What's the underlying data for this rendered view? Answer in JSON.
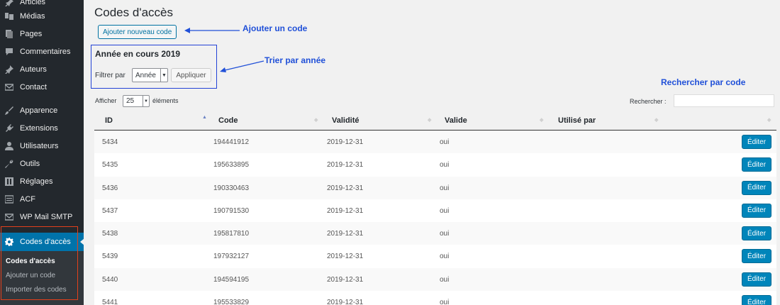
{
  "sidebar": {
    "items": [
      {
        "label": "Articles",
        "icon": "pin-icon"
      },
      {
        "label": "Médias",
        "icon": "media-icon"
      },
      {
        "label": "Pages",
        "icon": "page-icon"
      },
      {
        "label": "Commentaires",
        "icon": "comment-icon"
      },
      {
        "label": "Auteurs",
        "icon": "pin-icon"
      },
      {
        "label": "Contact",
        "icon": "mail-icon"
      },
      {
        "label": "Apparence",
        "icon": "brush-icon"
      },
      {
        "label": "Extensions",
        "icon": "plugin-icon"
      },
      {
        "label": "Utilisateurs",
        "icon": "user-icon"
      },
      {
        "label": "Outils",
        "icon": "wrench-icon"
      },
      {
        "label": "Réglages",
        "icon": "settings-icon"
      },
      {
        "label": "ACF",
        "icon": "list-icon"
      },
      {
        "label": "WP Mail SMTP",
        "icon": "mail-icon"
      }
    ],
    "active": {
      "label": "Codes d'accès",
      "icon": "gear-icon"
    },
    "submenu": [
      "Codes d'accès",
      "Ajouter un code",
      "Importer des codes"
    ]
  },
  "page": {
    "title": "Codes d'accès",
    "add_button": "Ajouter nouveau code"
  },
  "annotations": {
    "add": "Ajouter un code",
    "sort": "Trier par année",
    "search": "Rechercher par code",
    "color": "#2050d8"
  },
  "filter": {
    "heading": "Année en cours 2019",
    "label": "Filtrer par",
    "select_value": "Année",
    "apply_label": "Appliquer"
  },
  "list_controls": {
    "show_label": "Afficher",
    "show_value": "25",
    "entries_label": "éléments",
    "search_label": "Rechercher :",
    "search_value": ""
  },
  "table": {
    "columns": [
      "ID",
      "Code",
      "Validité",
      "Valide",
      "Utilisé par"
    ],
    "sorted_column": "ID",
    "edit_label": "Éditer",
    "rows": [
      {
        "id": "5434",
        "code": "194441912",
        "validity": "2019-12-31",
        "valid": "oui",
        "used_by": ""
      },
      {
        "id": "5435",
        "code": "195633895",
        "validity": "2019-12-31",
        "valid": "oui",
        "used_by": ""
      },
      {
        "id": "5436",
        "code": "190330463",
        "validity": "2019-12-31",
        "valid": "oui",
        "used_by": ""
      },
      {
        "id": "5437",
        "code": "190791530",
        "validity": "2019-12-31",
        "valid": "oui",
        "used_by": ""
      },
      {
        "id": "5438",
        "code": "195817810",
        "validity": "2019-12-31",
        "valid": "oui",
        "used_by": ""
      },
      {
        "id": "5439",
        "code": "197932127",
        "validity": "2019-12-31",
        "valid": "oui",
        "used_by": ""
      },
      {
        "id": "5440",
        "code": "194594195",
        "validity": "2019-12-31",
        "valid": "oui",
        "used_by": ""
      },
      {
        "id": "5441",
        "code": "195533829",
        "validity": "2019-12-31",
        "valid": "oui",
        "used_by": ""
      }
    ]
  },
  "colors": {
    "sidebar_bg": "#23282d",
    "accent": "#0073aa",
    "button_primary": "#0085ba",
    "highlight_frame": "#e2401c"
  }
}
